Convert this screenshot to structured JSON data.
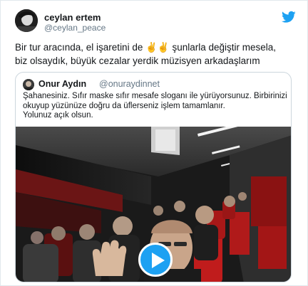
{
  "tweet": {
    "author_name": "ceylan ertem",
    "author_handle": "@ceylan_peace",
    "text_line1": "Bir tur aracında, el işaretini de ✌️✌️ şunlarla değiştir mesela,",
    "text_line2": "biz olsaydık, büyük cezalar yerdik müzisyen arkadaşlarım"
  },
  "quoted_tweet": {
    "author_name": "Onur Aydın",
    "author_handle": "@onuraydinnet",
    "text_line1": "Şahanesiniz. Sıfır maske sıfır mesafe sloganı ile yürüyorsunuz. Birbirinizi",
    "text_line2": "okuyup yüzünüze doğru da üflerseniz işlem tamamlanır.",
    "text_line3": "Yolunuz açık olsun."
  },
  "icons": {
    "brand": "twitter-bird-icon",
    "play": "play-icon"
  },
  "colors": {
    "accent": "#1da1f2",
    "secondary_text": "#657786",
    "border": "#ccd6dd"
  }
}
